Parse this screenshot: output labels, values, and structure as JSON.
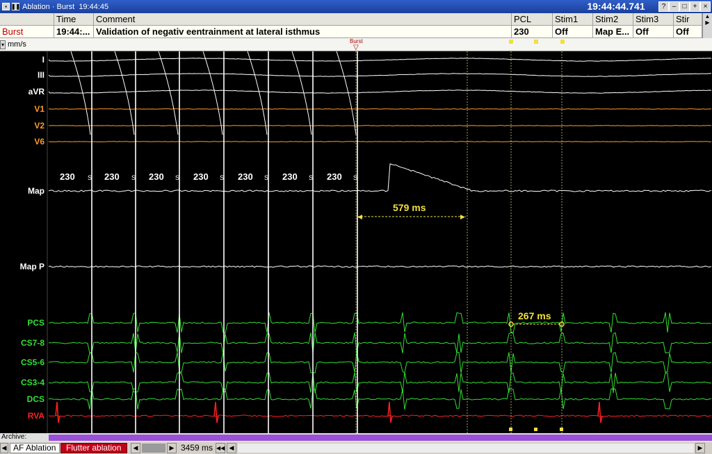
{
  "titlebar": {
    "title": "Ablation · Burst  19:44:45",
    "clock": "19:44:44.741",
    "buttons": [
      "?",
      "–",
      "□",
      "+",
      "×"
    ]
  },
  "grid": {
    "headers": [
      "",
      "Time",
      "Comment",
      "PCL",
      "Stim1",
      "Stim2",
      "Stim3",
      "Stir"
    ],
    "row": [
      "Burst",
      "19:44:...",
      "Validation of negativ eentrainment at lateral isthmus",
      "230",
      "Off",
      "Map E...",
      "Off",
      "Off"
    ]
  },
  "units": {
    "label": "mm/s",
    "marker": "Burst"
  },
  "channels": [
    {
      "name": "I",
      "color": "#ffffff"
    },
    {
      "name": "III",
      "color": "#ffffff"
    },
    {
      "name": "aVR",
      "color": "#ffffff"
    },
    {
      "name": "V1",
      "color": "#ff9a2a"
    },
    {
      "name": "V2",
      "color": "#ff9a2a"
    },
    {
      "name": "V6",
      "color": "#ff9a2a"
    },
    {
      "name": "Map",
      "color": "#ffffff"
    },
    {
      "name": "Map P",
      "color": "#ffffff"
    },
    {
      "name": "PCS",
      "color": "#33e033"
    },
    {
      "name": "CS7-8",
      "color": "#33e033"
    },
    {
      "name": "CS5-6",
      "color": "#33e033"
    },
    {
      "name": "CS3-4",
      "color": "#33e033"
    },
    {
      "name": "DCS",
      "color": "#33e033"
    },
    {
      "name": "RVA",
      "color": "#ff2020"
    }
  ],
  "pacing_labels": [
    "230",
    "230",
    "230",
    "230",
    "230",
    "230",
    "230"
  ],
  "stim_marker": "S",
  "measurements": {
    "ppi": "579 ms",
    "tcl": "267 ms"
  },
  "status": {
    "archive": "Archive:",
    "tabs": [
      "AF Ablation",
      "Flutter ablation"
    ],
    "duration": "3459 ms"
  },
  "colors": {
    "accent": "#f0e040",
    "ecg": "#ffffff",
    "v_leads": "#ff9a2a",
    "cs": "#33e033",
    "rva": "#ff2020",
    "progress": "#9a50d8"
  }
}
